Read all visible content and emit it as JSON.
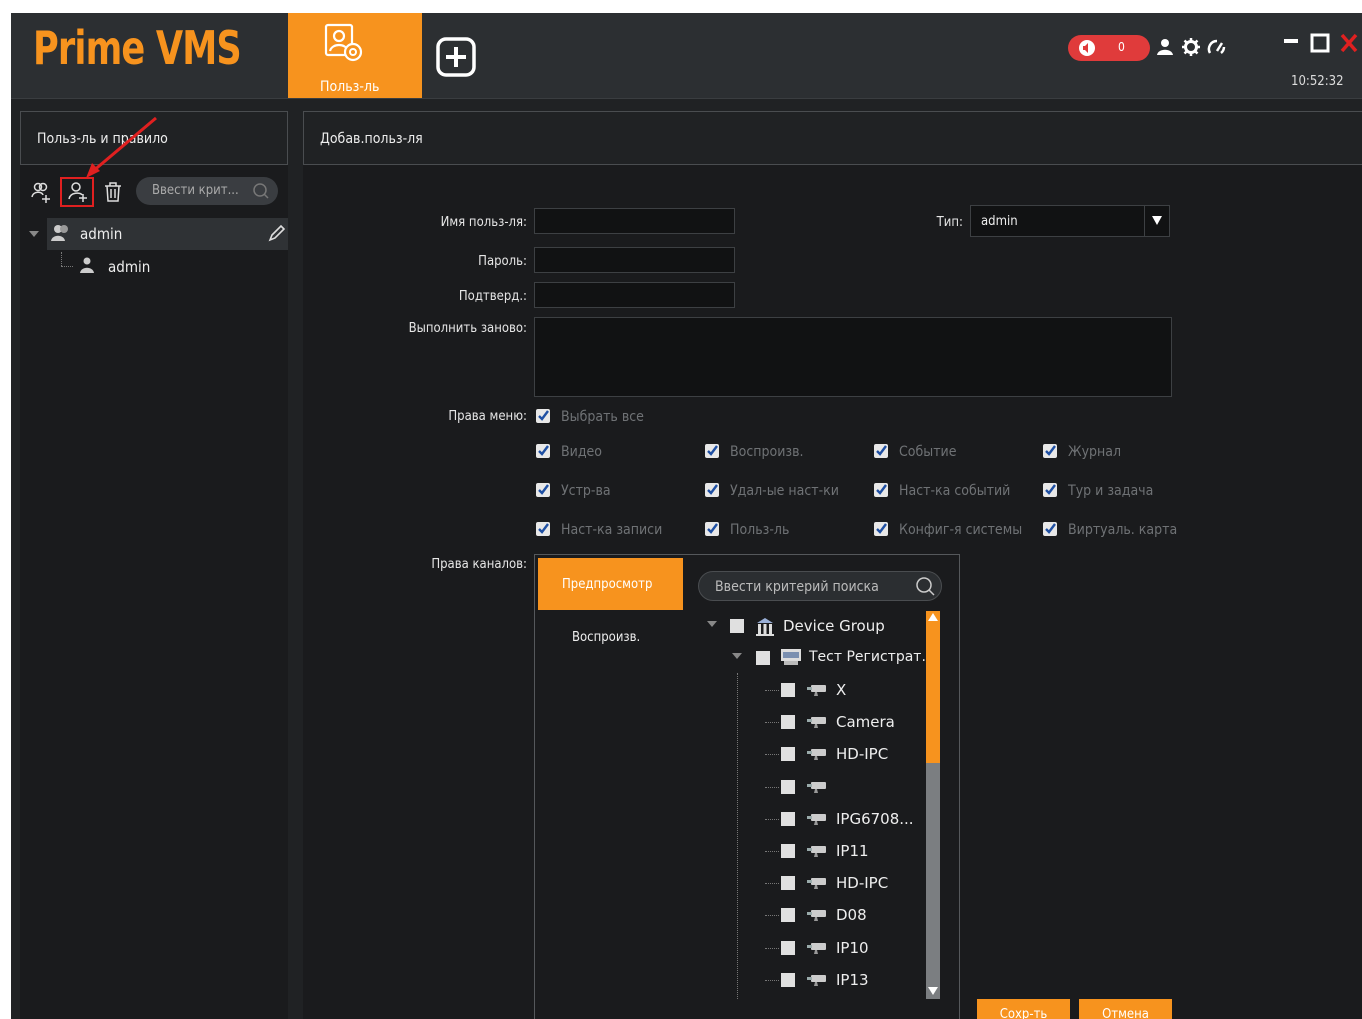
{
  "header": {
    "logo": "Prime VMS",
    "active_tab_label": "Польз-ль",
    "alarm_count": "0",
    "clock": "10:52:32"
  },
  "left": {
    "title": "Польз-ль и правило",
    "search_placeholder": "Ввести крит...",
    "tree": [
      {
        "label": "admin",
        "type": "group"
      },
      {
        "label": "admin",
        "type": "user"
      }
    ]
  },
  "form": {
    "title": "Добав.польз-ля",
    "username_label": "Имя польз-ля:",
    "password_label": "Пароль:",
    "confirm_label": "Подтверд.:",
    "repeat_label": "Выполнить заново:",
    "type_label": "Тип:",
    "type_value": "admin",
    "menu_rights_label": "Права меню:",
    "select_all": "Выбрать все",
    "menu_items": [
      "Видео",
      "Воспроизв.",
      "Событие",
      "Журнал",
      "Устр-ва",
      "Удал-ые наст-ки",
      "Наст-ка событий",
      "Тур и задача",
      "Наст-ка записи",
      "Польз-ль",
      "Конфиг-я системы",
      "Виртуаль. карта"
    ],
    "channel_rights_label": "Права каналов:",
    "channel_tabs": [
      "Предпросмотр",
      "Воспроизв."
    ],
    "channel_search_placeholder": "Ввести критерий поиска",
    "device_group": "Device Group",
    "recorder": "Тест Регистрат...",
    "cameras": [
      "X",
      "Camera",
      "HD-IPC",
      "",
      "IPG6708...",
      "IP11",
      "HD-IPC",
      "D08",
      "IP10",
      "IP13"
    ],
    "save_label": "Сохр-ть",
    "cancel_label": "Отмена"
  },
  "colors": {
    "accent": "#f7931e",
    "background": "#202224",
    "alarm": "#e03b3b",
    "annotation": "#e02020"
  }
}
